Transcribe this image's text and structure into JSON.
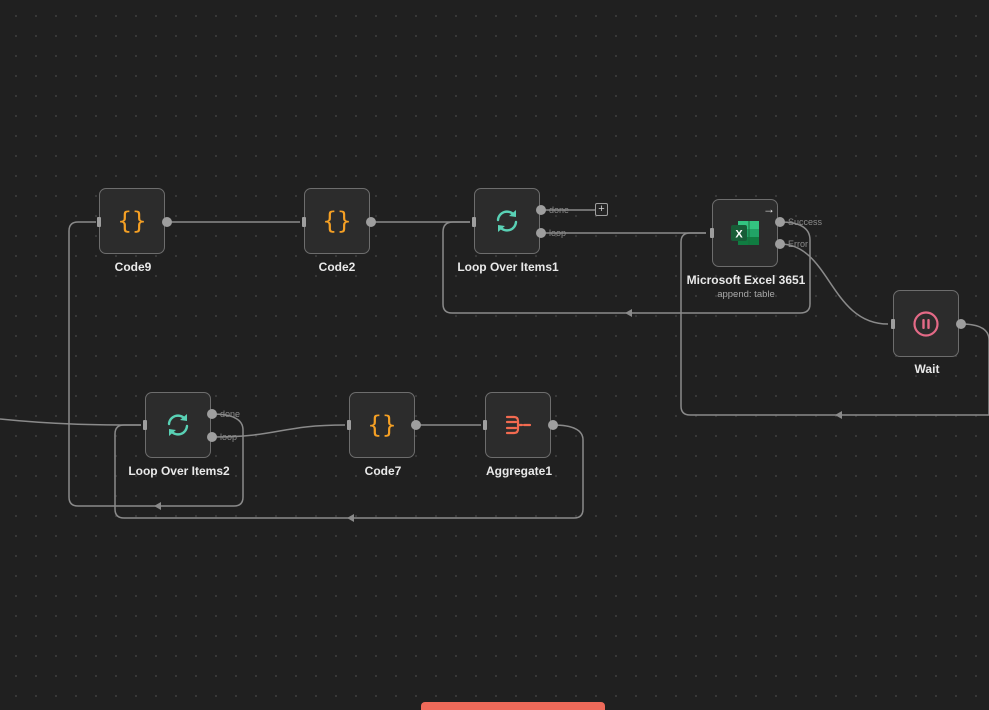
{
  "canvas": {
    "nodes": [
      {
        "id": "code9",
        "label": "Code9",
        "icon": "code-braces-icon"
      },
      {
        "id": "code2",
        "label": "Code2",
        "icon": "code-braces-icon"
      },
      {
        "id": "loop1",
        "label": "Loop Over Items1",
        "icon": "loop-arrows-icon",
        "outputs": [
          "done",
          "loop"
        ]
      },
      {
        "id": "excel",
        "label": "Microsoft Excel 3651",
        "subtitle": "append: table",
        "icon": "microsoft-excel-icon",
        "outputs": [
          "Success",
          "Error"
        ]
      },
      {
        "id": "wait",
        "label": "Wait",
        "icon": "pause-icon"
      },
      {
        "id": "loop2",
        "label": "Loop Over Items2",
        "icon": "loop-arrows-icon",
        "outputs": [
          "done",
          "loop"
        ]
      },
      {
        "id": "code7",
        "label": "Code7",
        "icon": "code-braces-icon"
      },
      {
        "id": "aggregate1",
        "label": "Aggregate1",
        "icon": "aggregate-icon"
      }
    ]
  },
  "colors": {
    "code_icon": "#f5a024",
    "loop_icon": "#59d1b5",
    "excel_icon": "#1e7a43",
    "wait_icon": "#e46a87",
    "aggregate_icon": "#f26a50",
    "edge": "#8a8a8a",
    "accent_bar": "#ee6a5a"
  }
}
